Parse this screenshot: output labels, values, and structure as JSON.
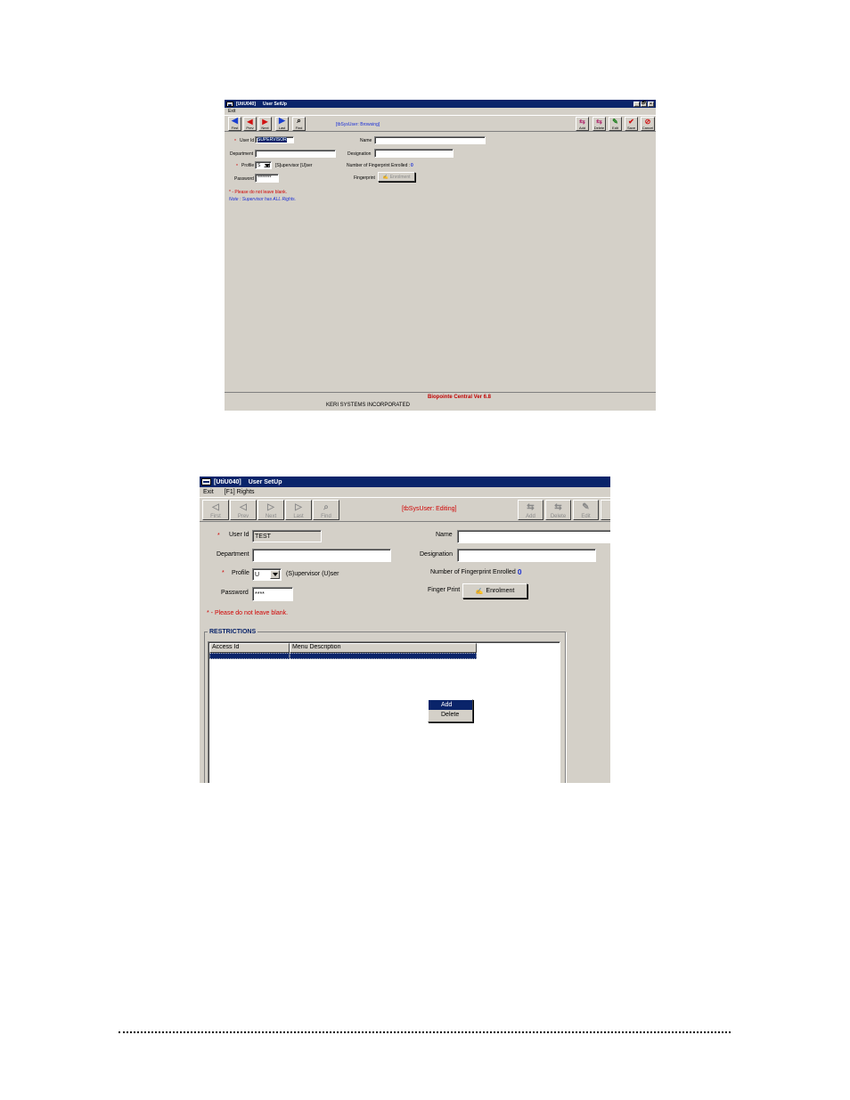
{
  "window1": {
    "title_id": "[UtiU040]",
    "title": "User SetUp",
    "window_buttons": [
      "_",
      "🗗",
      "×"
    ],
    "menu": [
      "Exit"
    ],
    "toolbar": {
      "nav": [
        {
          "label": "First",
          "icon": "◀",
          "icon_name": "first-arrow-icon",
          "color": "#1a3fcf"
        },
        {
          "label": "Prev",
          "icon": "◀",
          "icon_name": "prev-arrow-icon",
          "color": "#d01010"
        },
        {
          "label": "Next",
          "icon": "▶",
          "icon_name": "next-arrow-icon",
          "color": "#d01010"
        },
        {
          "label": "Last",
          "icon": "▶",
          "icon_name": "last-arrow-icon",
          "color": "#1a3fcf"
        },
        {
          "label": "Find",
          "icon": "⌕",
          "icon_name": "find-icon",
          "color": "#000000"
        }
      ],
      "status": "[tbSysUser: Browsing]",
      "actions": [
        {
          "label": "Add",
          "icon": "⇆",
          "icon_name": "add-icon",
          "color": "#b03070"
        },
        {
          "label": "Delete",
          "icon": "⇆",
          "icon_name": "delete-icon",
          "color": "#b03070"
        },
        {
          "label": "Edit",
          "icon": "✎",
          "icon_name": "edit-icon",
          "color": "#208020"
        },
        {
          "label": "Save",
          "icon": "✔",
          "icon_name": "save-check-icon",
          "color": "#d01010"
        },
        {
          "label": "Cancel",
          "icon": "⊘",
          "icon_name": "cancel-icon",
          "color": "#d01010"
        }
      ]
    },
    "form": {
      "user_id_label": "User Id",
      "user_id_value": "SUPERVISOR",
      "department_label": "Department",
      "department_value": "",
      "profile_label": "Profile",
      "profile_value": "S",
      "profile_hint": "[S]upervisor  [U]ser",
      "password_label": "Password",
      "password_value": "********",
      "name_label": "Name",
      "name_value": "",
      "designation_label": "Designation",
      "designation_value": "",
      "fingerprint_count_label": "Number of Fingerprint Enrolled :",
      "fingerprint_count_value": "0",
      "fingerprint_label": "Fingerprint",
      "enrolment_button": "Enrolment"
    },
    "notes": {
      "required_star": "*",
      "required_note": "* - Please do not leave blank.",
      "supervisor_note": "Note : Supervisor has ALL Rights."
    },
    "status_bar": {
      "version": "Biopointe Central Ver 6.8",
      "company": "KERI SYSTEMS INCORPORATED",
      "version_color": "#c00000"
    }
  },
  "window2": {
    "title_id": "[UtiU040]",
    "title": "User SetUp",
    "menu": [
      "Exit",
      "[F1] Rights"
    ],
    "toolbar": {
      "nav": [
        {
          "label": "First",
          "icon": "◁",
          "icon_name": "first-arrow-icon"
        },
        {
          "label": "Prev",
          "icon": "◁",
          "icon_name": "prev-arrow-icon"
        },
        {
          "label": "Next",
          "icon": "▷",
          "icon_name": "next-arrow-icon"
        },
        {
          "label": "Last",
          "icon": "▷",
          "icon_name": "last-arrow-icon"
        },
        {
          "label": "Find",
          "icon": "⌕",
          "icon_name": "find-icon"
        }
      ],
      "status": "[tbSysUser: Editing]",
      "actions": [
        {
          "label": "Add",
          "icon": "⇆",
          "icon_name": "add-icon"
        },
        {
          "label": "Delete",
          "icon": "⇆",
          "icon_name": "delete-icon"
        },
        {
          "label": "Edit",
          "icon": "✎",
          "icon_name": "edit-icon"
        }
      ]
    },
    "form": {
      "user_id_label": "User Id",
      "user_id_value": "TEST",
      "department_label": "Department",
      "department_value": "",
      "profile_label": "Profile",
      "profile_value": "U",
      "profile_hint": "(S)upervisor  (U)ser",
      "password_label": "Password",
      "password_value": "****",
      "name_label": "Name",
      "name_value": "",
      "designation_label": "Designation",
      "designation_value": "",
      "fingerprint_count_label": "Number of Fingerprint Enrolled :",
      "fingerprint_count_value": "0",
      "fingerprint_label": "Finger Print",
      "enrolment_button": "Enrolment"
    },
    "notes": {
      "required_star": "*",
      "required_note": "* - Please do not leave blank."
    },
    "restrictions": {
      "title": "RESTRICTIONS",
      "columns": [
        "Access Id",
        "Menu Description"
      ]
    },
    "context_menu": {
      "items": [
        "Add",
        "Delete"
      ],
      "highlighted": "Add"
    }
  }
}
